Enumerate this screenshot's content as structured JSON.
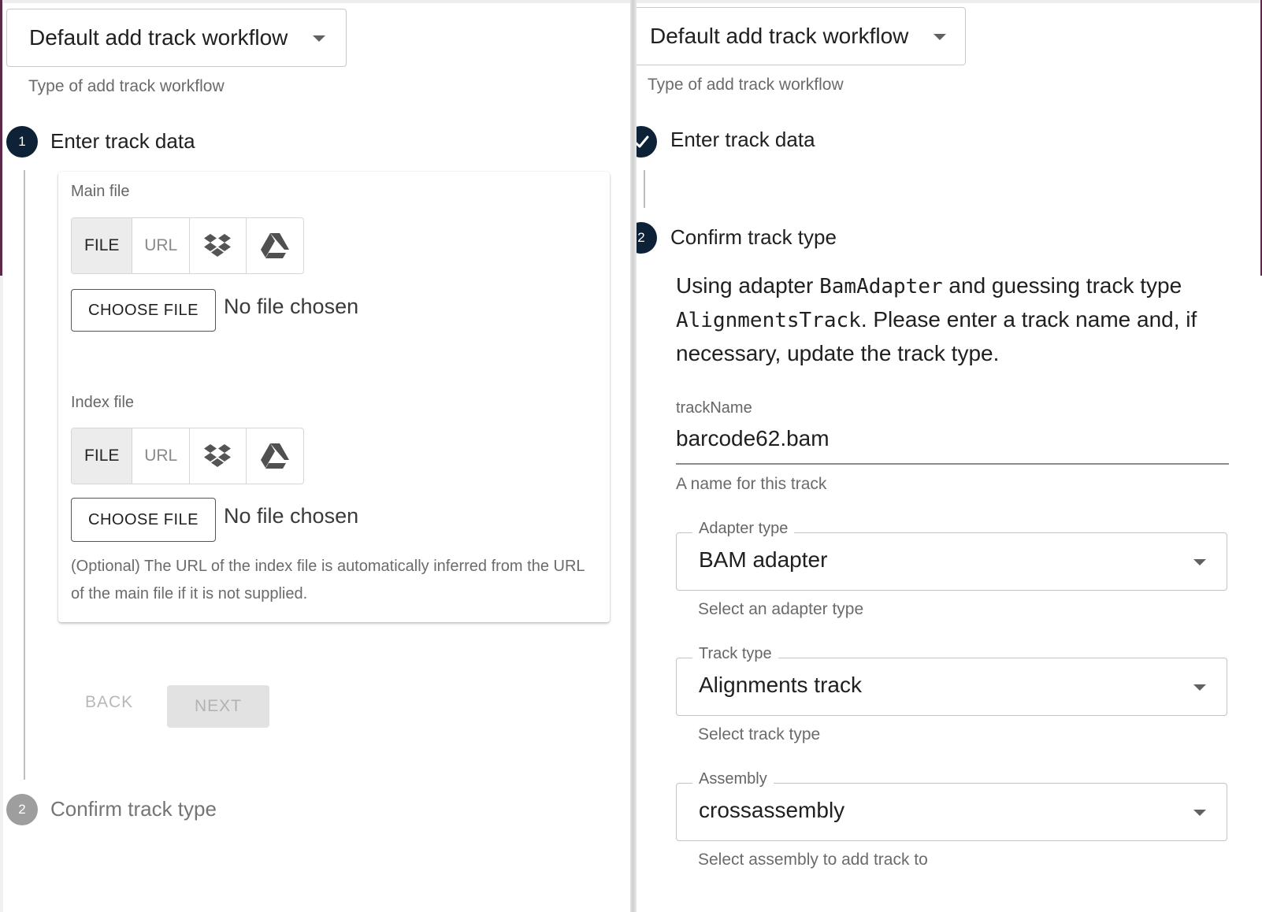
{
  "left": {
    "workflow_select": {
      "value": "Default add track workflow",
      "helper": "Type of add track workflow"
    },
    "steps": [
      {
        "number": "1",
        "label": "Enter track data"
      },
      {
        "number": "2",
        "label": "Confirm track type"
      }
    ],
    "main_file": {
      "label": "Main file",
      "toggles": {
        "file": "FILE",
        "url": "URL"
      },
      "choose_button": "CHOOSE FILE",
      "status": "No file chosen"
    },
    "index_file": {
      "label": "Index file",
      "toggles": {
        "file": "FILE",
        "url": "URL"
      },
      "choose_button": "CHOOSE FILE",
      "status": "No file chosen",
      "note": "(Optional) The URL of the index file is automatically inferred from the URL of the main file if it is not supplied."
    },
    "actions": {
      "back": "BACK",
      "next": "NEXT"
    }
  },
  "right": {
    "workflow_select": {
      "value": "Default add track workflow",
      "helper": "Type of add track workflow"
    },
    "steps": [
      {
        "label": "Enter track data"
      },
      {
        "number": "2",
        "label": "Confirm track type"
      }
    ],
    "description": {
      "part1": "Using adapter ",
      "adapter": "BamAdapter",
      "part2": " and guessing track type ",
      "track_type": "AlignmentsTrack",
      "part3": ". Please enter a track name and, if necessary, update the track type."
    },
    "track_name": {
      "label": "trackName",
      "value": "barcode62.bam",
      "helper": "A name for this track"
    },
    "adapter_type": {
      "label": "Adapter type",
      "value": "BAM adapter",
      "helper": "Select an adapter type"
    },
    "track_type": {
      "label": "Track type",
      "value": "Alignments track",
      "helper": "Select track type"
    },
    "assembly": {
      "label": "Assembly",
      "value": "crossassembly",
      "helper": "Select assembly to add track to"
    }
  },
  "icons": [
    "chevron-down-icon",
    "dropbox-icon",
    "google-drive-icon",
    "check-icon"
  ],
  "colors": {
    "step_active": "#0d2137",
    "step_inactive": "#9e9e9e"
  }
}
